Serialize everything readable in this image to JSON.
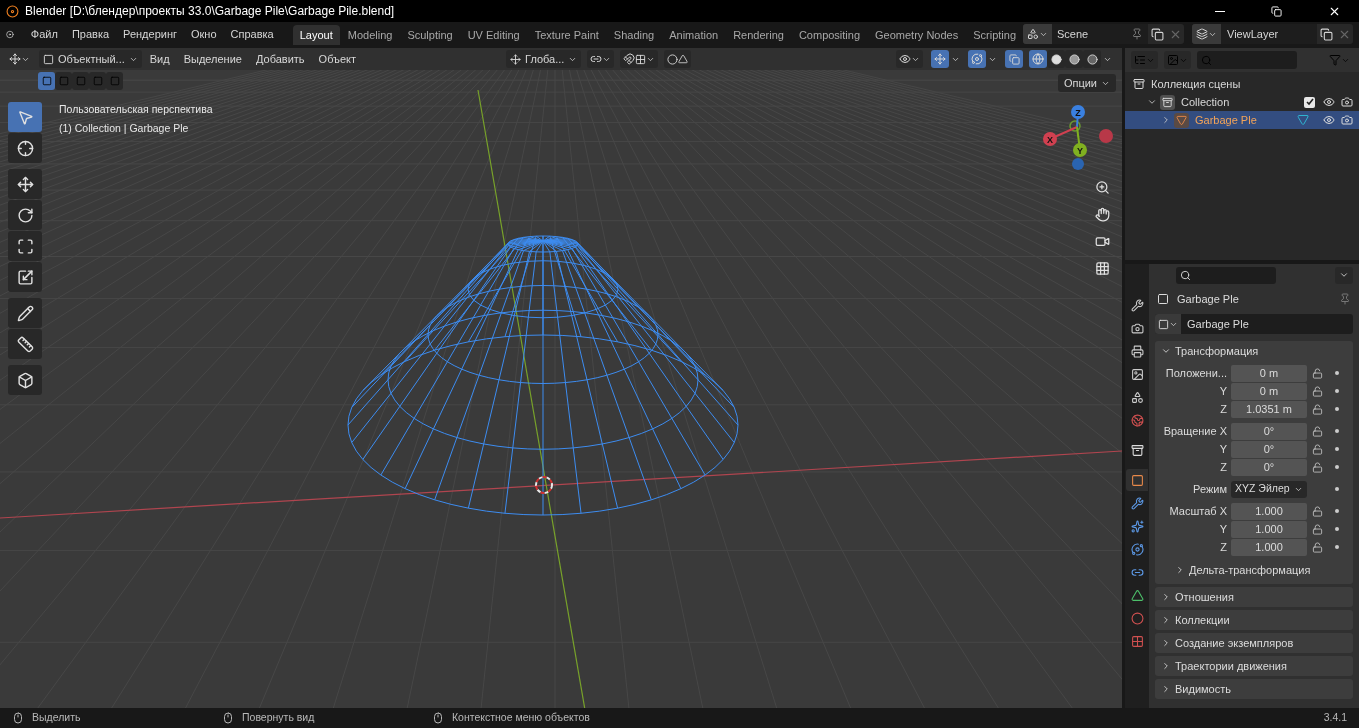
{
  "window": {
    "title": "Blender [D:\\блендер\\проекты 33.0\\Garbage Pile\\Garbage Pile.blend]"
  },
  "menu": [
    "Файл",
    "Правка",
    "Рендеринг",
    "Окно",
    "Справка"
  ],
  "workspaces": [
    {
      "label": "Layout",
      "selected": true
    },
    {
      "label": "Modeling",
      "selected": false
    },
    {
      "label": "Sculpting",
      "selected": false
    },
    {
      "label": "UV Editing",
      "selected": false
    },
    {
      "label": "Texture Paint",
      "selected": false
    },
    {
      "label": "Shading",
      "selected": false
    },
    {
      "label": "Animation",
      "selected": false
    },
    {
      "label": "Rendering",
      "selected": false
    },
    {
      "label": "Compositing",
      "selected": false
    },
    {
      "label": "Geometry Nodes",
      "selected": false
    },
    {
      "label": "Scripting",
      "selected": false
    }
  ],
  "scene": {
    "name": "Scene"
  },
  "view_layer": {
    "name": "ViewLayer"
  },
  "viewport": {
    "mode": "Объектный...",
    "menus": [
      "Вид",
      "Выделение",
      "Добавить",
      "Объект"
    ],
    "orientation": "Глоба...",
    "options": "Опции",
    "gizmos_on": true,
    "overlays_on": true,
    "xray_on": true,
    "shading": [
      {
        "selected": true
      },
      {
        "selected": false
      },
      {
        "selected": false
      },
      {
        "selected": false
      }
    ],
    "selection_modes": [
      {
        "selected": true
      },
      {
        "selected": false
      },
      {
        "selected": false
      },
      {
        "selected": false
      },
      {
        "selected": false
      }
    ],
    "info": [
      "Пользовательская перспектива",
      "(1) Collection | Garbage Ple"
    ],
    "tools": [
      {
        "selected": true
      },
      {
        "selected": false
      },
      {
        "selected": false
      },
      {
        "selected": false
      },
      {
        "selected": false
      },
      {
        "selected": false
      },
      {
        "selected": false
      },
      {
        "selected": false
      },
      {
        "selected": false
      }
    ],
    "gizmo_axes": [
      "X",
      "Y",
      "Z"
    ]
  },
  "outliner": {
    "items": [
      {
        "kind": "scene_collection",
        "label": "Коллекция сцены",
        "children": [
          {
            "kind": "collection",
            "label": "Collection",
            "expanded": true,
            "checked": true,
            "selected": false,
            "children": [
              {
                "kind": "object",
                "label": "Garbage Ple",
                "expanded": false,
                "selected": true
              }
            ]
          }
        ]
      }
    ]
  },
  "properties": {
    "tabs": [
      {
        "selected": false
      },
      {
        "selected": false
      },
      {
        "selected": false
      },
      {
        "selected": false
      },
      {
        "selected": false
      },
      {
        "selected": false
      },
      {
        "selected": false
      },
      {
        "selected": true
      },
      {
        "selected": false
      },
      {
        "selected": false
      },
      {
        "selected": false
      },
      {
        "selected": false
      },
      {
        "selected": false
      },
      {
        "selected": false
      },
      {
        "selected": false
      }
    ],
    "object_name": "Garbage Ple",
    "data_name": "Garbage Ple",
    "transform": {
      "title": "Трансформация",
      "expanded": true,
      "groups": [
        [
          {
            "kind": "number",
            "label": "Положени...",
            "value": "0 m"
          },
          {
            "kind": "number",
            "label": "Y",
            "value": "0 m"
          },
          {
            "kind": "number",
            "label": "Z",
            "value": "1.0351 m"
          }
        ],
        [
          {
            "kind": "number",
            "label": "Вращение X",
            "value": "0°"
          },
          {
            "kind": "number",
            "label": "Y",
            "value": "0°"
          },
          {
            "kind": "number",
            "label": "Z",
            "value": "0°"
          }
        ],
        [
          {
            "kind": "dropdown",
            "label": "Режим",
            "value": "XYZ Эйлер"
          }
        ],
        [
          {
            "kind": "number",
            "label": "Масштаб X",
            "value": "1.000"
          },
          {
            "kind": "number",
            "label": "Y",
            "value": "1.000"
          },
          {
            "kind": "number",
            "label": "Z",
            "value": "1.000"
          }
        ]
      ],
      "delta": {
        "title": "Дельта-трансформация",
        "expanded": false
      }
    },
    "panels": [
      {
        "title": "Отношения",
        "expanded": false
      },
      {
        "title": "Коллекции",
        "expanded": false
      },
      {
        "title": "Создание экземпляров",
        "expanded": false
      },
      {
        "title": "Траектории движения",
        "expanded": false
      },
      {
        "title": "Видимость",
        "expanded": false
      }
    ]
  },
  "status_bar": {
    "hints": [
      "Выделить",
      "Повернуть вид",
      "Контекстное меню объектов"
    ],
    "version": "3.4.1"
  }
}
